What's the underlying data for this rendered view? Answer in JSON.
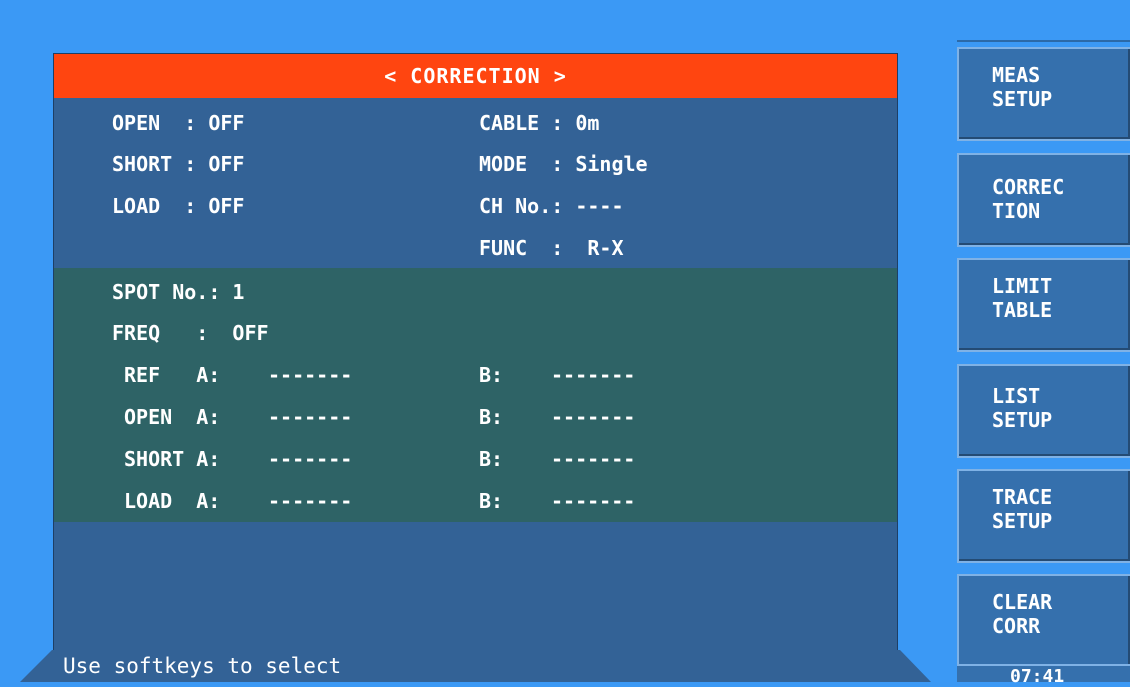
{
  "title": "< CORRECTION >",
  "settings": {
    "open": "OPEN  : OFF",
    "short": "SHORT : OFF",
    "load": "LOAD  : OFF",
    "cable": "CABLE : 0m",
    "mode": "MODE  : Single",
    "ch_no": "CH No.: ----",
    "func": "FUNC  :  R-X"
  },
  "spot": {
    "spot_no": "SPOT No.: 1",
    "freq": "FREQ   :  OFF",
    "rows": [
      {
        "label": "REF   A:",
        "a_value": "-------",
        "b_label": "B:",
        "b_value": "-------"
      },
      {
        "label": "OPEN  A:",
        "a_value": "-------",
        "b_label": "B:",
        "b_value": "-------"
      },
      {
        "label": "SHORT A:",
        "a_value": "-------",
        "b_label": "B:",
        "b_value": "-------"
      },
      {
        "label": "LOAD  A:",
        "a_value": "-------",
        "b_label": "B:",
        "b_value": "-------"
      }
    ]
  },
  "status_text": "Use softkeys to select",
  "softkeys": [
    {
      "label": "MEAS\nSETUP"
    },
    {
      "label": "CORREC\nTION"
    },
    {
      "label": "LIMIT\nTABLE"
    },
    {
      "label": "LIST\nSETUP"
    },
    {
      "label": "TRACE\nSETUP"
    },
    {
      "label": "CLEAR\nCORR"
    }
  ],
  "clock": "07:41",
  "colors": {
    "background": "#3b99f5",
    "screen": "#336296",
    "title_bar": "#ff4510",
    "spot_area": "#2e6366",
    "text": "#ffffff"
  }
}
